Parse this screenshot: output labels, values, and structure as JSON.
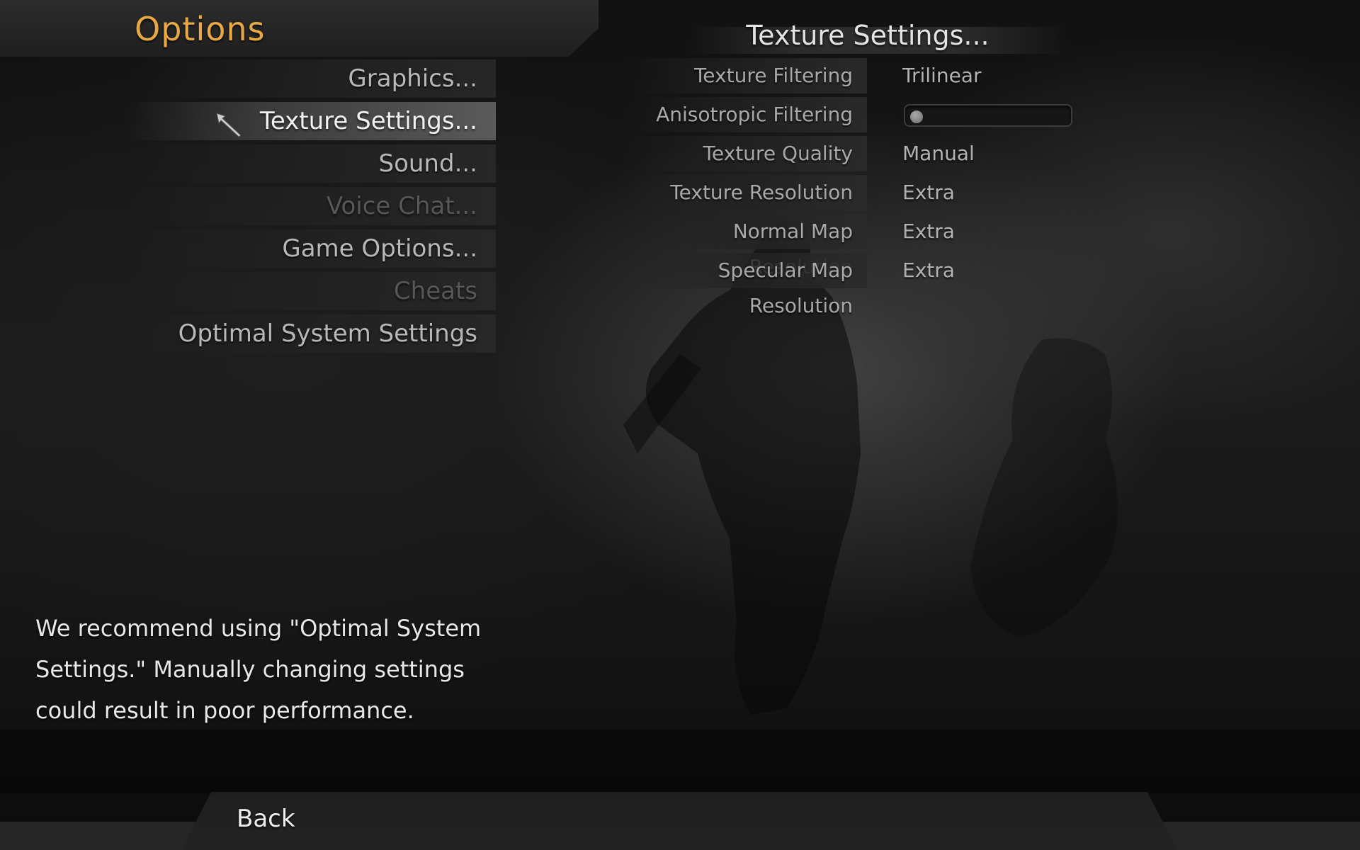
{
  "header": {
    "title": "Options"
  },
  "menu": {
    "items": [
      {
        "label": "Graphics...",
        "state": "normal"
      },
      {
        "label": "Texture Settings...",
        "state": "selected"
      },
      {
        "label": "Sound...",
        "state": "normal"
      },
      {
        "label": "Voice Chat...",
        "state": "disabled"
      },
      {
        "label": "Game Options...",
        "state": "normal"
      },
      {
        "label": "Cheats",
        "state": "disabled"
      },
      {
        "label": "Optimal System Settings",
        "state": "normal"
      }
    ],
    "cursor_icon": "mouse-pointer-arrow"
  },
  "panel": {
    "title": "Texture Settings...",
    "settings": [
      {
        "label": "Texture Filtering",
        "value": "Trilinear"
      },
      {
        "label": "Anisotropic Filtering",
        "slider_level": 0
      },
      {
        "label": "Texture Quality",
        "value": "Manual"
      },
      {
        "label": "Texture Resolution",
        "value": "Extra"
      },
      {
        "label": "Normal Map Resolution",
        "value": "Extra"
      },
      {
        "label": "Specular Map Resolution",
        "value": "Extra"
      }
    ]
  },
  "recommendation": {
    "lines": [
      "We recommend using \"Optimal System",
      "Settings.\"  Manually changing settings",
      "could result in poor performance."
    ]
  },
  "footer": {
    "back_label": "Back"
  },
  "colors": {
    "title_accent": "#e8a843",
    "selected_item_bg": "#5a5a5a",
    "disabled_text": "#575757"
  }
}
